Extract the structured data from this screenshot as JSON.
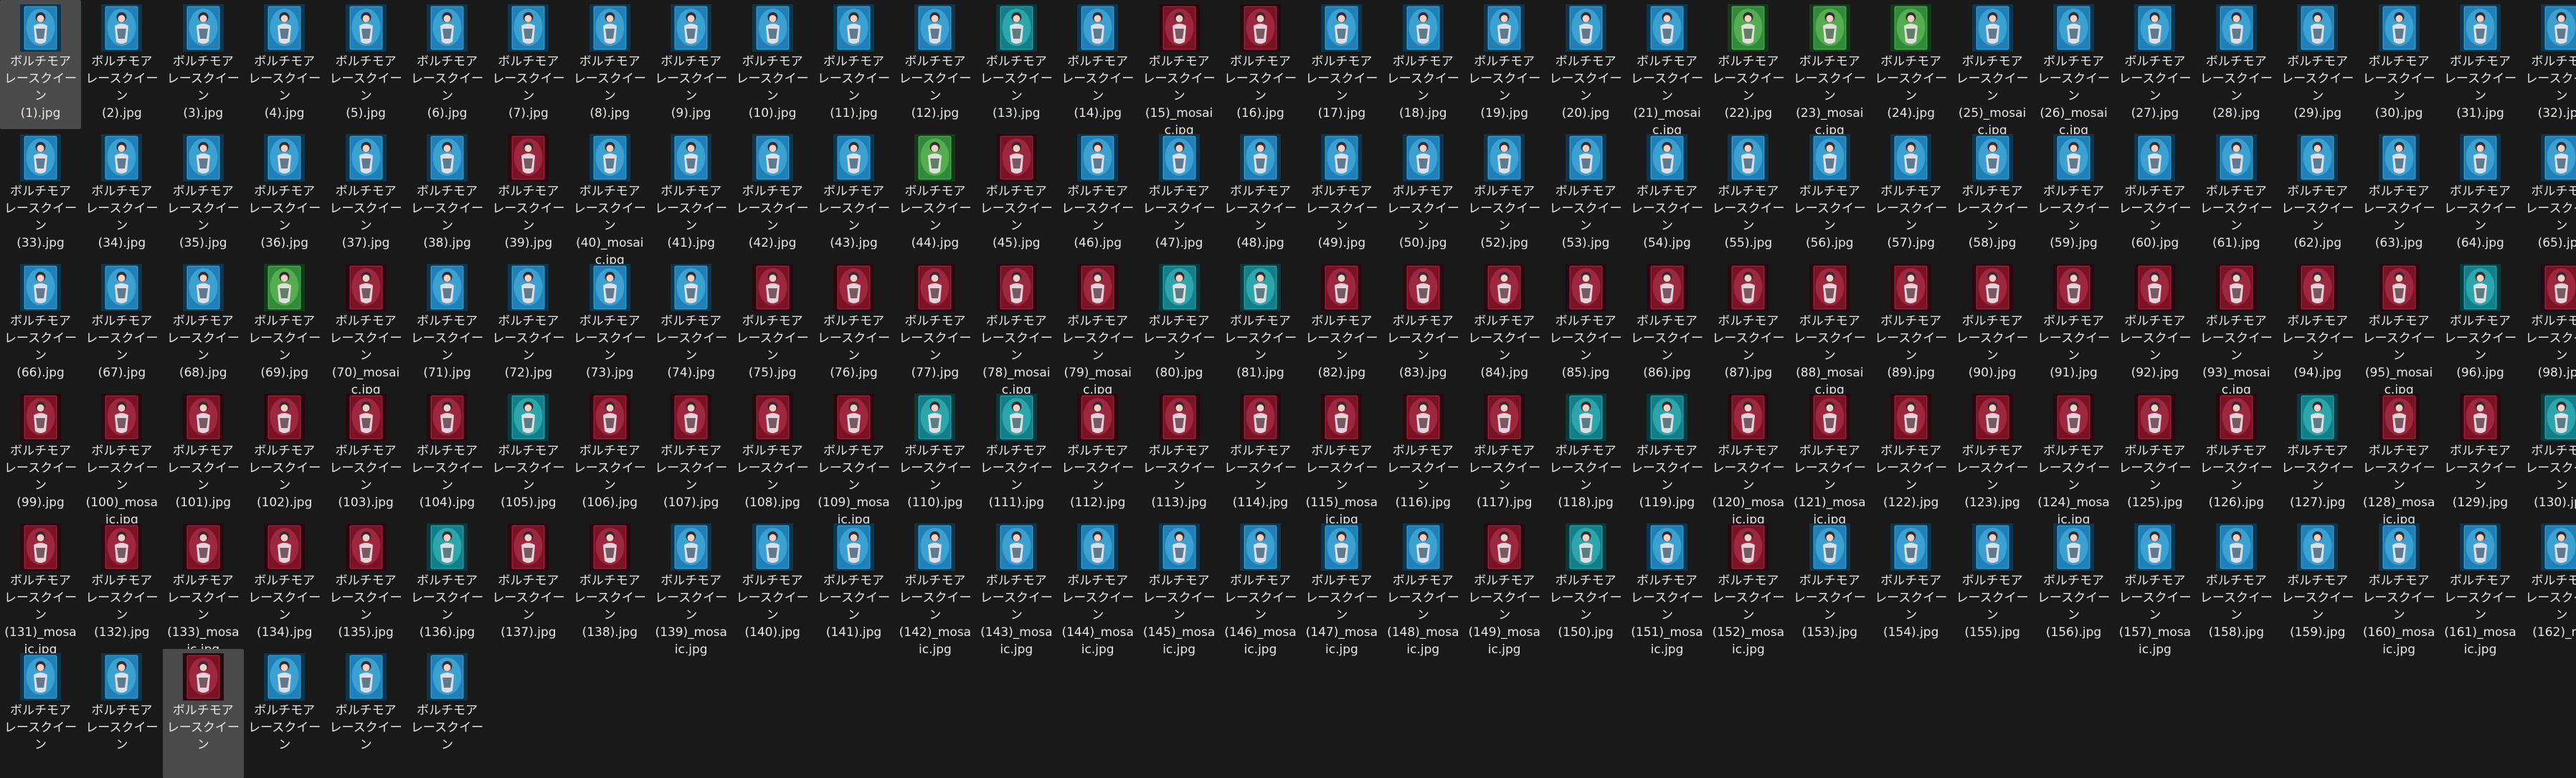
{
  "app": {
    "selected_indices": [
      0,
      162
    ],
    "colors": {
      "background": "#191919",
      "selection": "#4a4a4a",
      "text": "#e6e6e6"
    }
  },
  "palettes": {
    "blue": {
      "bg": "#1f7fb8",
      "glow": "#6fe3ff",
      "dark": "#0c3550"
    },
    "red": {
      "bg": "#7a1224",
      "glow": "#e05070",
      "dark": "#2b0810"
    },
    "green": {
      "bg": "#2f8a3a",
      "glow": "#9af07a",
      "dark": "#103a18"
    },
    "teal": {
      "bg": "#117f8a",
      "glow": "#5ff0e8",
      "dark": "#073a40"
    }
  },
  "files": [
    {
      "name": "ボルチモア\nレースクイーン\n(1).jpg",
      "thumb": "blue"
    },
    {
      "name": "ボルチモア\nレースクイーン\n(2).jpg",
      "thumb": "blue"
    },
    {
      "name": "ボルチモア\nレースクイーン\n(3).jpg",
      "thumb": "blue"
    },
    {
      "name": "ボルチモア\nレースクイーン\n(4).jpg",
      "thumb": "blue"
    },
    {
      "name": "ボルチモア\nレースクイーン\n(5).jpg",
      "thumb": "blue"
    },
    {
      "name": "ボルチモア\nレースクイーン\n(6).jpg",
      "thumb": "blue"
    },
    {
      "name": "ボルチモア\nレースクイーン\n(7).jpg",
      "thumb": "blue"
    },
    {
      "name": "ボルチモア\nレースクイーン\n(8).jpg",
      "thumb": "blue"
    },
    {
      "name": "ボルチモア\nレースクイーン\n(9).jpg",
      "thumb": "blue"
    },
    {
      "name": "ボルチモア\nレースクイーン\n(10).jpg",
      "thumb": "blue"
    },
    {
      "name": "ボルチモア\nレースクイーン\n(11).jpg",
      "thumb": "blue"
    },
    {
      "name": "ボルチモア\nレースクイーン\n(12).jpg",
      "thumb": "blue"
    },
    {
      "name": "ボルチモア\nレースクイーン\n(13).jpg",
      "thumb": "teal"
    },
    {
      "name": "ボルチモア\nレースクイーン\n(14).jpg",
      "thumb": "blue"
    },
    {
      "name": "ボルチモア\nレースクイーン\n(15)_mosai\nc.jpg",
      "thumb": "red"
    },
    {
      "name": "ボルチモア\nレースクイーン\n(16).jpg",
      "thumb": "red"
    },
    {
      "name": "ボルチモア\nレースクイーン\n(17).jpg",
      "thumb": "blue"
    },
    {
      "name": "ボルチモア\nレースクイーン\n(18).jpg",
      "thumb": "blue"
    },
    {
      "name": "ボルチモア\nレースクイーン\n(19).jpg",
      "thumb": "blue"
    },
    {
      "name": "ボルチモア\nレースクイーン\n(20).jpg",
      "thumb": "blue"
    },
    {
      "name": "ボルチモア\nレースクイーン\n(21)_mosai\nc.jpg",
      "thumb": "blue"
    },
    {
      "name": "ボルチモア\nレースクイーン\n(22).jpg",
      "thumb": "green"
    },
    {
      "name": "ボルチモア\nレースクイーン\n(23)_mosai\nc.jpg",
      "thumb": "green"
    },
    {
      "name": "ボルチモア\nレースクイーン\n(24).jpg",
      "thumb": "green"
    },
    {
      "name": "ボルチモア\nレースクイーン\n(25)_mosai\nc.jpg",
      "thumb": "blue"
    },
    {
      "name": "ボルチモア\nレースクイーン\n(26)_mosai\nc.jpg",
      "thumb": "blue"
    },
    {
      "name": "ボルチモア\nレースクイーン\n(27).jpg",
      "thumb": "blue"
    },
    {
      "name": "ボルチモア\nレースクイーン\n(28).jpg",
      "thumb": "blue"
    },
    {
      "name": "ボルチモア\nレースクイーン\n(29).jpg",
      "thumb": "blue"
    },
    {
      "name": "ボルチモア\nレースクイーン\n(30).jpg",
      "thumb": "blue"
    },
    {
      "name": "ボルチモア\nレースクイーン\n(31).jpg",
      "thumb": "blue"
    },
    {
      "name": "ボルチモア\nレースクイーン\n(32).jpg",
      "thumb": "blue"
    },
    {
      "name": "ボルチモア\nレースクイーン\n(33).jpg",
      "thumb": "blue"
    },
    {
      "name": "ボルチモア\nレースクイーン\n(34).jpg",
      "thumb": "blue"
    },
    {
      "name": "ボルチモア\nレースクイーン\n(35).jpg",
      "thumb": "blue"
    },
    {
      "name": "ボルチモア\nレースクイーン\n(36).jpg",
      "thumb": "blue"
    },
    {
      "name": "ボルチモア\nレースクイーン\n(37).jpg",
      "thumb": "blue"
    },
    {
      "name": "ボルチモア\nレースクイーン\n(38).jpg",
      "thumb": "blue"
    },
    {
      "name": "ボルチモア\nレースクイーン\n(39).jpg",
      "thumb": "red"
    },
    {
      "name": "ボルチモア\nレースクイーン\n(40)_mosai\nc.jpg",
      "thumb": "blue"
    },
    {
      "name": "ボルチモア\nレースクイーン\n(41).jpg",
      "thumb": "blue"
    },
    {
      "name": "ボルチモア\nレースクイーン\n(42).jpg",
      "thumb": "blue"
    },
    {
      "name": "ボルチモア\nレースクイーン\n(43).jpg",
      "thumb": "blue"
    },
    {
      "name": "ボルチモア\nレースクイーン\n(44).jpg",
      "thumb": "green"
    },
    {
      "name": "ボルチモア\nレースクイーン\n(45).jpg",
      "thumb": "red"
    },
    {
      "name": "ボルチモア\nレースクイーン\n(46).jpg",
      "thumb": "blue"
    },
    {
      "name": "ボルチモア\nレースクイーン\n(47).jpg",
      "thumb": "blue"
    },
    {
      "name": "ボルチモア\nレースクイーン\n(48).jpg",
      "thumb": "blue"
    },
    {
      "name": "ボルチモア\nレースクイーン\n(49).jpg",
      "thumb": "blue"
    },
    {
      "name": "ボルチモア\nレースクイーン\n(50).jpg",
      "thumb": "blue"
    },
    {
      "name": "ボルチモア\nレースクイーン\n(52).jpg",
      "thumb": "blue"
    },
    {
      "name": "ボルチモア\nレースクイーン\n(53).jpg",
      "thumb": "blue"
    },
    {
      "name": "ボルチモア\nレースクイーン\n(54).jpg",
      "thumb": "blue"
    },
    {
      "name": "ボルチモア\nレースクイーン\n(55).jpg",
      "thumb": "blue"
    },
    {
      "name": "ボルチモア\nレースクイーン\n(56).jpg",
      "thumb": "blue"
    },
    {
      "name": "ボルチモア\nレースクイーン\n(57).jpg",
      "thumb": "blue"
    },
    {
      "name": "ボルチモア\nレースクイーン\n(58).jpg",
      "thumb": "blue"
    },
    {
      "name": "ボルチモア\nレースクイーン\n(59).jpg",
      "thumb": "blue"
    },
    {
      "name": "ボルチモア\nレースクイーン\n(60).jpg",
      "thumb": "blue"
    },
    {
      "name": "ボルチモア\nレースクイーン\n(61).jpg",
      "thumb": "blue"
    },
    {
      "name": "ボルチモア\nレースクイーン\n(62).jpg",
      "thumb": "blue"
    },
    {
      "name": "ボルチモア\nレースクイーン\n(63).jpg",
      "thumb": "blue"
    },
    {
      "name": "ボルチモア\nレースクイーン\n(64).jpg",
      "thumb": "blue"
    },
    {
      "name": "ボルチモア\nレースクイーン\n(65).jpg",
      "thumb": "blue"
    },
    {
      "name": "ボルチモア\nレースクイーン\n(66).jpg",
      "thumb": "blue"
    },
    {
      "name": "ボルチモア\nレースクイーン\n(67).jpg",
      "thumb": "blue"
    },
    {
      "name": "ボルチモア\nレースクイーン\n(68).jpg",
      "thumb": "blue"
    },
    {
      "name": "ボルチモア\nレースクイーン\n(69).jpg",
      "thumb": "green"
    },
    {
      "name": "ボルチモア\nレースクイーン\n(70)_mosai\nc.jpg",
      "thumb": "red"
    },
    {
      "name": "ボルチモア\nレースクイーン\n(71).jpg",
      "thumb": "blue"
    },
    {
      "name": "ボルチモア\nレースクイーン\n(72).jpg",
      "thumb": "blue"
    },
    {
      "name": "ボルチモア\nレースクイーン\n(73).jpg",
      "thumb": "blue"
    },
    {
      "name": "ボルチモア\nレースクイーン\n(74).jpg",
      "thumb": "blue"
    },
    {
      "name": "ボルチモア\nレースクイーン\n(75).jpg",
      "thumb": "red"
    },
    {
      "name": "ボルチモア\nレースクイーン\n(76).jpg",
      "thumb": "red"
    },
    {
      "name": "ボルチモア\nレースクイーン\n(77).jpg",
      "thumb": "red"
    },
    {
      "name": "ボルチモア\nレースクイーン\n(78)_mosai\nc.jpg",
      "thumb": "red"
    },
    {
      "name": "ボルチモア\nレースクイーン\n(79)_mosai\nc.jpg",
      "thumb": "red"
    },
    {
      "name": "ボルチモア\nレースクイーン\n(80).jpg",
      "thumb": "teal"
    },
    {
      "name": "ボルチモア\nレースクイーン\n(81).jpg",
      "thumb": "teal"
    },
    {
      "name": "ボルチモア\nレースクイーン\n(82).jpg",
      "thumb": "red"
    },
    {
      "name": "ボルチモア\nレースクイーン\n(83).jpg",
      "thumb": "red"
    },
    {
      "name": "ボルチモア\nレースクイーン\n(84).jpg",
      "thumb": "red"
    },
    {
      "name": "ボルチモア\nレースクイーン\n(85).jpg",
      "thumb": "red"
    },
    {
      "name": "ボルチモア\nレースクイーン\n(86).jpg",
      "thumb": "red"
    },
    {
      "name": "ボルチモア\nレースクイーン\n(87).jpg",
      "thumb": "red"
    },
    {
      "name": "ボルチモア\nレースクイーン\n(88)_mosai\nc.jpg",
      "thumb": "red"
    },
    {
      "name": "ボルチモア\nレースクイーン\n(89).jpg",
      "thumb": "red"
    },
    {
      "name": "ボルチモア\nレースクイーン\n(90).jpg",
      "thumb": "red"
    },
    {
      "name": "ボルチモア\nレースクイーン\n(91).jpg",
      "thumb": "red"
    },
    {
      "name": "ボルチモア\nレースクイーン\n(92).jpg",
      "thumb": "red"
    },
    {
      "name": "ボルチモア\nレースクイーン\n(93)_mosai\nc.jpg",
      "thumb": "red"
    },
    {
      "name": "ボルチモア\nレースクイーン\n(94).jpg",
      "thumb": "red"
    },
    {
      "name": "ボルチモア\nレースクイーン\n(95)_mosai\nc.jpg",
      "thumb": "red"
    },
    {
      "name": "ボルチモア\nレースクイーン\n(96).jpg",
      "thumb": "teal"
    },
    {
      "name": "ボルチモア\nレースクイーン\n(98).jpg",
      "thumb": "red"
    },
    {
      "name": "ボルチモア\nレースクイーン\n(99).jpg",
      "thumb": "red"
    },
    {
      "name": "ボルチモア\nレースクイーン\n(100)_mosa\nic.jpg",
      "thumb": "red"
    },
    {
      "name": "ボルチモア\nレースクイーン\n(101).jpg",
      "thumb": "red"
    },
    {
      "name": "ボルチモア\nレースクイーン\n(102).jpg",
      "thumb": "red"
    },
    {
      "name": "ボルチモア\nレースクイーン\n(103).jpg",
      "thumb": "red"
    },
    {
      "name": "ボルチモア\nレースクイーン\n(104).jpg",
      "thumb": "red"
    },
    {
      "name": "ボルチモア\nレースクイーン\n(105).jpg",
      "thumb": "teal"
    },
    {
      "name": "ボルチモア\nレースクイーン\n(106).jpg",
      "thumb": "red"
    },
    {
      "name": "ボルチモア\nレースクイーン\n(107).jpg",
      "thumb": "red"
    },
    {
      "name": "ボルチモア\nレースクイーン\n(108).jpg",
      "thumb": "red"
    },
    {
      "name": "ボルチモア\nレースクイーン\n(109)_mosa\nic.jpg",
      "thumb": "red"
    },
    {
      "name": "ボルチモア\nレースクイーン\n(110).jpg",
      "thumb": "teal"
    },
    {
      "name": "ボルチモア\nレースクイーン\n(111).jpg",
      "thumb": "teal"
    },
    {
      "name": "ボルチモア\nレースクイーン\n(112).jpg",
      "thumb": "red"
    },
    {
      "name": "ボルチモア\nレースクイーン\n(113).jpg",
      "thumb": "red"
    },
    {
      "name": "ボルチモア\nレースクイーン\n(114).jpg",
      "thumb": "red"
    },
    {
      "name": "ボルチモア\nレースクイーン\n(115)_mosa\nic.jpg",
      "thumb": "red"
    },
    {
      "name": "ボルチモア\nレースクイーン\n(116).jpg",
      "thumb": "red"
    },
    {
      "name": "ボルチモア\nレースクイーン\n(117).jpg",
      "thumb": "red"
    },
    {
      "name": "ボルチモア\nレースクイーン\n(118).jpg",
      "thumb": "teal"
    },
    {
      "name": "ボルチモア\nレースクイーン\n(119).jpg",
      "thumb": "teal"
    },
    {
      "name": "ボルチモア\nレースクイーン\n(120)_mosa\nic.jpg",
      "thumb": "red"
    },
    {
      "name": "ボルチモア\nレースクイーン\n(121)_mosa\nic.jpg",
      "thumb": "red"
    },
    {
      "name": "ボルチモア\nレースクイーン\n(122).jpg",
      "thumb": "red"
    },
    {
      "name": "ボルチモア\nレースクイーン\n(123).jpg",
      "thumb": "red"
    },
    {
      "name": "ボルチモア\nレースクイーン\n(124)_mosa\nic.jpg",
      "thumb": "red"
    },
    {
      "name": "ボルチモア\nレースクイーン\n(125).jpg",
      "thumb": "red"
    },
    {
      "name": "ボルチモア\nレースクイーン\n(126).jpg",
      "thumb": "red"
    },
    {
      "name": "ボルチモア\nレースクイーン\n(127).jpg",
      "thumb": "teal"
    },
    {
      "name": "ボルチモア\nレースクイーン\n(128)_mosa\nic.jpg",
      "thumb": "red"
    },
    {
      "name": "ボルチモア\nレースクイーン\n(129).jpg",
      "thumb": "red"
    },
    {
      "name": "ボルチモア\nレースクイーン\n(130).jpg",
      "thumb": "teal"
    },
    {
      "name": "ボルチモア\nレースクイーン\n(131)_mosa\nic.jpg",
      "thumb": "red"
    },
    {
      "name": "ボルチモア\nレースクイーン\n(132).jpg",
      "thumb": "red"
    },
    {
      "name": "ボルチモア\nレースクイーン\n(133)_mosa\nic.jpg",
      "thumb": "red"
    },
    {
      "name": "ボルチモア\nレースクイーン\n(134).jpg",
      "thumb": "red"
    },
    {
      "name": "ボルチモア\nレースクイーン\n(135).jpg",
      "thumb": "red"
    },
    {
      "name": "ボルチモア\nレースクイーン\n(136).jpg",
      "thumb": "teal"
    },
    {
      "name": "ボルチモア\nレースクイーン\n(137).jpg",
      "thumb": "red"
    },
    {
      "name": "ボルチモア\nレースクイーン\n(138).jpg",
      "thumb": "red"
    },
    {
      "name": "ボルチモア\nレースクイーン\n(139)_mosa\nic.jpg",
      "thumb": "blue"
    },
    {
      "name": "ボルチモア\nレースクイーン\n(140).jpg",
      "thumb": "blue"
    },
    {
      "name": "ボルチモア\nレースクイーン\n(141).jpg",
      "thumb": "blue"
    },
    {
      "name": "ボルチモア\nレースクイーン\n(142)_mosa\nic.jpg",
      "thumb": "blue"
    },
    {
      "name": "ボルチモア\nレースクイーン\n(143)_mosa\nic.jpg",
      "thumb": "blue"
    },
    {
      "name": "ボルチモア\nレースクイーン\n(144)_mosa\nic.jpg",
      "thumb": "blue"
    },
    {
      "name": "ボルチモア\nレースクイーン\n(145)_mosa\nic.jpg",
      "thumb": "blue"
    },
    {
      "name": "ボルチモア\nレースクイーン\n(146)_mosa\nic.jpg",
      "thumb": "blue"
    },
    {
      "name": "ボルチモア\nレースクイーン\n(147)_mosa\nic.jpg",
      "thumb": "blue"
    },
    {
      "name": "ボルチモア\nレースクイーン\n(148)_mosa\nic.jpg",
      "thumb": "blue"
    },
    {
      "name": "ボルチモア\nレースクイーン\n(149)_mosa\nic.jpg",
      "thumb": "red"
    },
    {
      "name": "ボルチモア\nレースクイーン\n(150).jpg",
      "thumb": "teal"
    },
    {
      "name": "ボルチモア\nレースクイーン\n(151)_mosa\nic.jpg",
      "thumb": "blue"
    },
    {
      "name": "ボルチモア\nレースクイーン\n(152)_mosa\nic.jpg",
      "thumb": "red"
    },
    {
      "name": "ボルチモア\nレースクイーン\n(153).jpg",
      "thumb": "blue"
    },
    {
      "name": "ボルチモア\nレースクイーン\n(154).jpg",
      "thumb": "blue"
    },
    {
      "name": "ボルチモア\nレースクイーン\n(155).jpg",
      "thumb": "blue"
    },
    {
      "name": "ボルチモア\nレースクイーン\n(156).jpg",
      "thumb": "blue"
    },
    {
      "name": "ボルチモア\nレースクイーン\n(157)_mosa\nic.jpg",
      "thumb": "blue"
    },
    {
      "name": "ボルチモア\nレースクイーン\n(158).jpg",
      "thumb": "blue"
    },
    {
      "name": "ボルチモア\nレースクイーン\n(159).jpg",
      "thumb": "blue"
    },
    {
      "name": "ボルチモア\nレースクイーン\n(160)_mosa\nic.jpg",
      "thumb": "blue"
    },
    {
      "name": "ボルチモア\nレースクイーン\n(161)_mosa\nic.jpg",
      "thumb": "blue"
    },
    {
      "name": "ボルチモア\nレースクイーン\n(162)_mo",
      "thumb": "blue"
    },
    {
      "name": "ボルチモア\nレースクイーン",
      "thumb": "blue"
    },
    {
      "name": "ボルチモア\nレースクイーン",
      "thumb": "blue"
    },
    {
      "name": "ボルチモア\nレースクイーン",
      "thumb": "red"
    },
    {
      "name": "ボルチモア\nレースクイーン",
      "thumb": "blue"
    },
    {
      "name": "ボルチモア\nレースクイーン",
      "thumb": "blue"
    },
    {
      "name": "ボルチモア\nレースクイーン",
      "thumb": "blue"
    }
  ]
}
